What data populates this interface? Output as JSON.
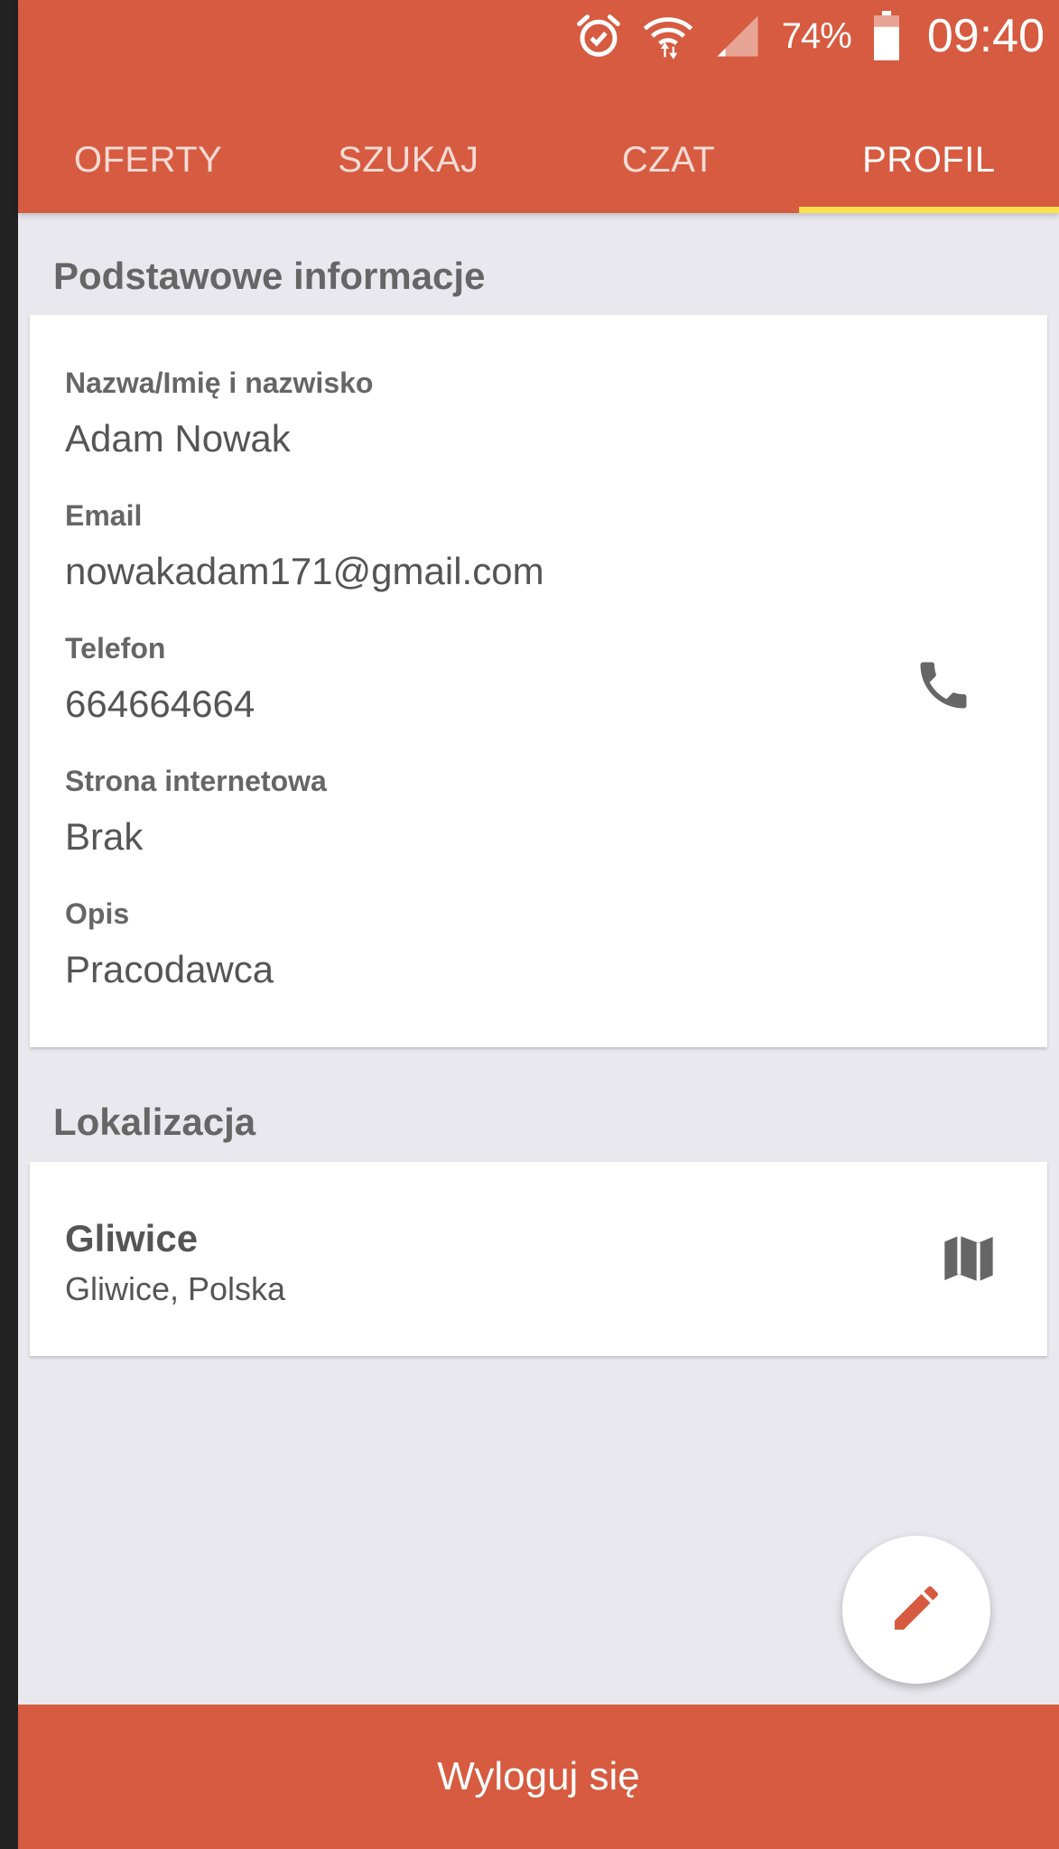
{
  "status_bar": {
    "battery_percent": "74%",
    "time": "09:40",
    "icons": [
      "alarm-icon",
      "wifi-icon",
      "signal-icon",
      "battery-icon"
    ]
  },
  "tabs": [
    {
      "label": "OFERTY",
      "active": false
    },
    {
      "label": "SZUKAJ",
      "active": false
    },
    {
      "label": "CZAT",
      "active": false
    },
    {
      "label": "PROFIL",
      "active": true
    }
  ],
  "basic_info": {
    "title": "Podstawowe informacje",
    "fields": [
      {
        "label": "Nazwa/Imię i nazwisko",
        "value": "Adam Nowak"
      },
      {
        "label": "Email",
        "value": "nowakadam171@gmail.com"
      },
      {
        "label": "Telefon",
        "value": "664664664",
        "icon": "phone-icon"
      },
      {
        "label": "Strona internetowa",
        "value": "Brak"
      },
      {
        "label": "Opis",
        "value": "Pracodawca"
      }
    ]
  },
  "location": {
    "title": "Lokalizacja",
    "name": "Gliwice",
    "detail": "Gliwice, Polska",
    "icon": "map-icon"
  },
  "fab": {
    "icon": "pencil-icon"
  },
  "logout": {
    "label": "Wyloguj się"
  },
  "colors": {
    "primary": "#d65b40",
    "tab_indicator": "#ffe24a",
    "background": "#e8e8ee",
    "card": "#ffffff",
    "text": "#555555"
  }
}
